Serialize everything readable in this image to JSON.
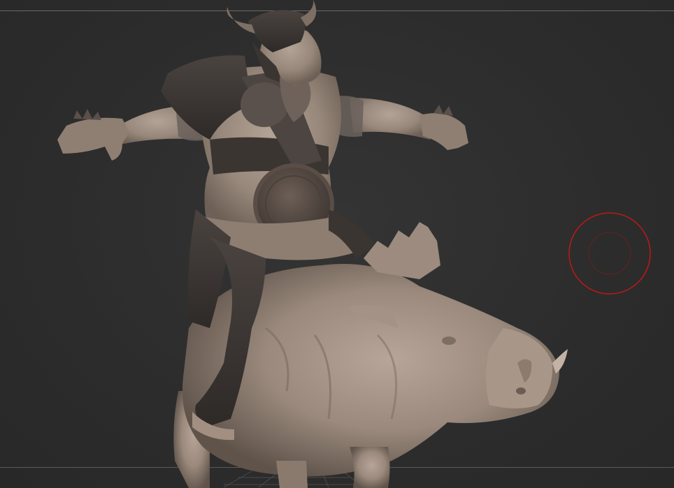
{
  "viewport": {
    "background_color": "#2d2d2d",
    "model_color": "#9a8a7d",
    "armor_color": "#3e3836",
    "brush_color": "#c01818"
  },
  "model": {
    "subject": "armored-orc-rider-on-boar",
    "icon": "sculpt-mesh"
  },
  "brush": {
    "icon": "brush-cursor-icon"
  }
}
